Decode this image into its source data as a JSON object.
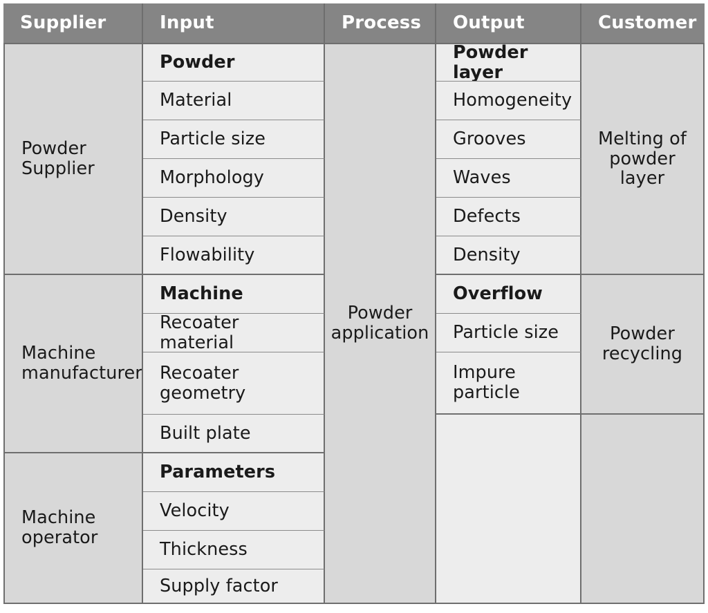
{
  "diagram": {
    "type": "sipoc-table",
    "title": "SIPOC diagram for powder application",
    "colors": {
      "header_background": "#858585",
      "header_text": "#ffffff",
      "dark_cell_background": "#d8d8d8",
      "light_cell_background": "#ededed",
      "border": "#6e6e6e",
      "inner_border": "#8a8a8a",
      "text": "#1a1a1a"
    }
  },
  "header": {
    "supplier": "Supplier",
    "input": "Input",
    "process": "Process",
    "output": "Output",
    "customer": "Customer"
  },
  "supplier": {
    "row1": "Powder\nSupplier",
    "row1_line1": "Powder",
    "row1_line2": "Supplier",
    "row2": "Machine\nmanufacturer",
    "row2_line1": "Machine",
    "row2_line2": "manufacturer",
    "row3": "Machine\noperator",
    "row3_line1": "Machine",
    "row3_line2": "operator"
  },
  "input": {
    "groups": [
      {
        "title": "Powder",
        "items": [
          "Material",
          "Particle size",
          "Morphology",
          "Density",
          "Flowability"
        ]
      },
      {
        "title": "Machine",
        "items": [
          "Recoater material",
          "Recoater geometry",
          "Built plate"
        ]
      },
      {
        "title": "Parameters",
        "items": [
          "Velocity",
          "Thickness",
          "Supply factor"
        ]
      }
    ]
  },
  "process": {
    "label": "Powder application",
    "line1": "Powder",
    "line2": "application"
  },
  "output": {
    "groups": [
      {
        "title": "Powder layer",
        "items": [
          "Homogeneity",
          "Grooves",
          "Waves",
          "Defects",
          "Density"
        ]
      },
      {
        "title": "Overflow",
        "items": [
          "Particle size",
          "Impure particle"
        ]
      }
    ],
    "empty_cell": ""
  },
  "customer": {
    "row1": "Melting of powder layer",
    "row1_line1": "Melting of",
    "row1_line2": "powder",
    "row1_line3": "layer",
    "row2": "Powder recycling",
    "row2_line1": "Powder",
    "row2_line2": "recycling",
    "row3": ""
  }
}
